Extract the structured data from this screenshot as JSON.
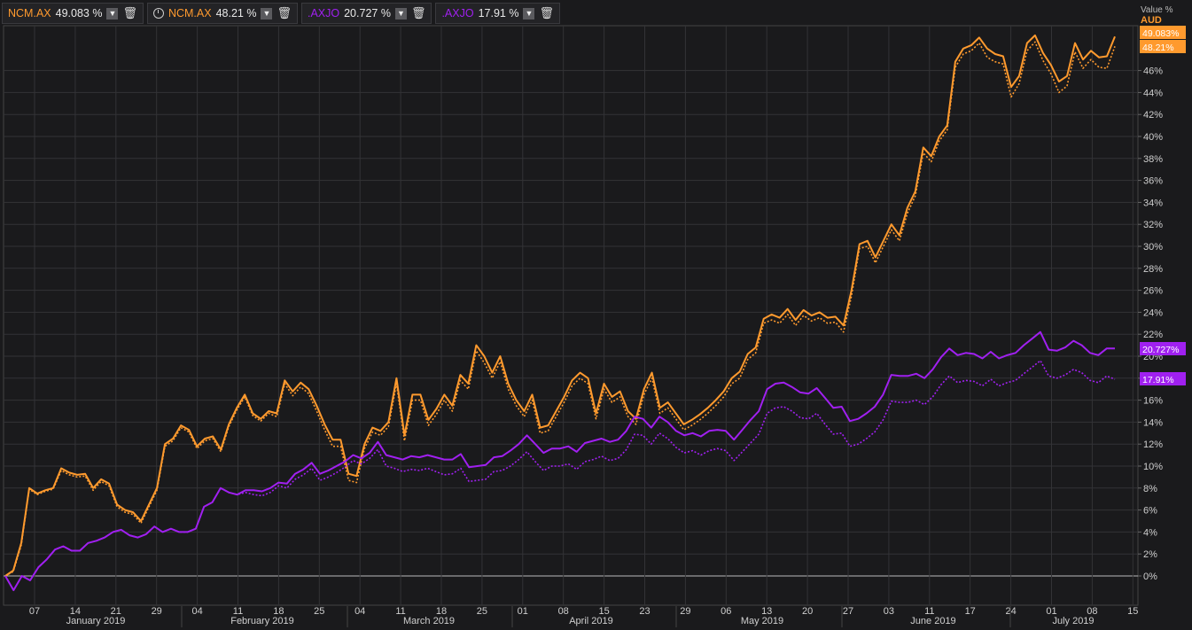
{
  "legend": [
    {
      "symbol": "NCM.AX",
      "value": "49.083 %",
      "color": "#ff9a2e",
      "clock": false
    },
    {
      "symbol": "NCM.AX",
      "value": "48.21 %",
      "color": "#ff9a2e",
      "clock": true
    },
    {
      "symbol": ".AXJO",
      "value": "20.727 %",
      "color": "#a020f0",
      "clock": false
    },
    {
      "symbol": ".AXJO",
      "value": "17.91 %",
      "color": "#a020f0",
      "clock": false
    }
  ],
  "axis_header": {
    "line1": "Value %",
    "line2": "AUD"
  },
  "colors": {
    "orange": "#ff9a2e",
    "purple": "#a020f0",
    "bg": "#1a1a1c",
    "grid": "#333336"
  },
  "chart_data": {
    "type": "line",
    "ylim": [
      -2,
      52
    ],
    "yticks": [
      "0%",
      "2%",
      "4%",
      "6%",
      "8%",
      "10%",
      "12%",
      "14%",
      "16%",
      "18%",
      "20%",
      "22%",
      "24%",
      "26%",
      "28%",
      "30%",
      "32%",
      "34%",
      "36%",
      "38%",
      "40%",
      "42%",
      "44%",
      "46%"
    ],
    "xticks": [
      "07",
      "14",
      "21",
      "29",
      "04",
      "11",
      "18",
      "25",
      "04",
      "11",
      "18",
      "25",
      "01",
      "08",
      "15",
      "23",
      "29",
      "06",
      "13",
      "20",
      "27",
      "03",
      "11",
      "17",
      "24",
      "01",
      "08",
      "15"
    ],
    "months": [
      "January 2019",
      "February 2019",
      "March 2019",
      "April 2019",
      "May 2019",
      "June 2019",
      "July 2019"
    ],
    "end_labels": [
      "49.083%",
      "48.21%",
      "20.727%",
      "17.91%"
    ],
    "series": [
      {
        "name": "NCM.AX",
        "style": "solid",
        "color": "#ff9a2e",
        "values": [
          0,
          0.5,
          3,
          8,
          7.5,
          7.8,
          8,
          9.8,
          9.4,
          9.2,
          9.3,
          8,
          8.8,
          8.4,
          6.5,
          6,
          5.8,
          5,
          6.5,
          8,
          12,
          12.5,
          13.7,
          13.3,
          11.8,
          12.5,
          12.7,
          11.5,
          13.8,
          15.3,
          16.5,
          14.8,
          14.3,
          15,
          14.8,
          17.8,
          16.8,
          17.6,
          17,
          15.5,
          13.8,
          12.4,
          12.4,
          9.3,
          9.1,
          12,
          13.5,
          13.2,
          14,
          18,
          12.8,
          16.5,
          16.5,
          14.2,
          15.2,
          16.5,
          15.5,
          18.3,
          17.5,
          21,
          20,
          18.5,
          20,
          17.5,
          16,
          15,
          16.5,
          13.5,
          13.7,
          15,
          16.3,
          17.8,
          18.5,
          18,
          14.8,
          17.5,
          16.3,
          16.8,
          15,
          14.3,
          17,
          18.5,
          15.3,
          15.8,
          14.8,
          13.8,
          14.2,
          14.7,
          15.3,
          16,
          16.8,
          18,
          18.6,
          20.2,
          20.8,
          23.4,
          23.8,
          23.5,
          24.3,
          23.3,
          24.2,
          23.7,
          24,
          23.5,
          23.6,
          22.8,
          26,
          30.2,
          30.5,
          29,
          30.5,
          32,
          31,
          33.5,
          35,
          39,
          38.2,
          40,
          41,
          46.8,
          48,
          48.3,
          49,
          48,
          47.5,
          47.3,
          44.5,
          45.5,
          48.5,
          49.2,
          47.6,
          46.5,
          45,
          45.5,
          48.5,
          47,
          47.8,
          47.2,
          47.3,
          49.1
        ]
      },
      {
        "name": "NCM.AX",
        "style": "dotted",
        "color": "#ff9a2e",
        "values": [
          0,
          0.4,
          2.8,
          7.9,
          7.4,
          7.7,
          7.9,
          9.6,
          9.2,
          9,
          9.1,
          7.8,
          8.6,
          8.2,
          6.3,
          5.8,
          5.6,
          4.8,
          6.3,
          7.8,
          11.8,
          12.3,
          13.5,
          13.1,
          11.6,
          12.3,
          12.5,
          11.3,
          13.6,
          15.1,
          16.3,
          14.6,
          14.1,
          14.8,
          14.5,
          17.5,
          16.4,
          17.2,
          16.6,
          15,
          13.3,
          11.8,
          11.8,
          8.7,
          8.5,
          11.6,
          13.1,
          12.8,
          13.6,
          17.5,
          12.3,
          16,
          16,
          13.7,
          14.7,
          16,
          15,
          17.8,
          17,
          20.5,
          19.4,
          18,
          19.5,
          17,
          15.5,
          14.5,
          16,
          13,
          13.2,
          14.5,
          15.8,
          17.3,
          18,
          17.5,
          14.3,
          17,
          15.8,
          16.3,
          14.5,
          13.8,
          16.5,
          18,
          14.8,
          15.3,
          14.3,
          13.3,
          13.7,
          14.2,
          14.8,
          15.5,
          16.3,
          17.5,
          18,
          19.7,
          20.3,
          23,
          23.3,
          23,
          23.8,
          22.8,
          23.7,
          23.2,
          23.5,
          23,
          23.1,
          22.2,
          25.5,
          29.8,
          30,
          28.5,
          30,
          31.5,
          30.5,
          33,
          34.6,
          38.5,
          37.7,
          39.6,
          40.6,
          46.3,
          47.5,
          47.8,
          48.5,
          47.2,
          46.8,
          46.6,
          43.6,
          44.8,
          47.8,
          48.6,
          46.9,
          45.7,
          44,
          44.6,
          47.7,
          46.2,
          47,
          46.3,
          46.2,
          48.2
        ]
      },
      {
        "name": ".AXJO",
        "style": "solid",
        "color": "#a020f0",
        "values": [
          0,
          -1.3,
          0,
          -0.4,
          0.8,
          1.5,
          2.4,
          2.7,
          2.3,
          2.3,
          3,
          3.2,
          3.5,
          4,
          4.2,
          3.7,
          3.5,
          3.8,
          4.5,
          4,
          4.3,
          4,
          4,
          4.3,
          6.3,
          6.7,
          8,
          7.6,
          7.4,
          7.8,
          7.8,
          7.7,
          8,
          8.5,
          8.4,
          9.3,
          9.7,
          10.3,
          9.3,
          9.6,
          10,
          10.4,
          11,
          10.7,
          11.2,
          12.2,
          11,
          10.8,
          10.6,
          10.9,
          10.8,
          11,
          10.8,
          10.6,
          10.6,
          11.1,
          9.9,
          10,
          10.1,
          10.8,
          10.9,
          11.4,
          12,
          12.8,
          12,
          11.2,
          11.6,
          11.6,
          11.8,
          11.3,
          12.1,
          12.3,
          12.5,
          12.2,
          12.4,
          13.2,
          14.5,
          14.3,
          13.5,
          14.5,
          14,
          13.2,
          12.8,
          13,
          12.7,
          13.2,
          13.3,
          13.2,
          12.4,
          13.3,
          14.2,
          15,
          17,
          17.5,
          17.6,
          17.2,
          16.7,
          16.6,
          17.1,
          16.2,
          15.3,
          15.4,
          14.1,
          14.3,
          14.8,
          15.4,
          16.5,
          18.3,
          18.2,
          18.2,
          18.4,
          18,
          18.8,
          19.9,
          20.7,
          20.1,
          20.3,
          20.2,
          19.8,
          20.4,
          19.8,
          20.1,
          20.3,
          21,
          21.6,
          22.2,
          20.6,
          20.5,
          20.8,
          21.4,
          21,
          20.3,
          20.1,
          20.7,
          20.7
        ]
      },
      {
        "name": ".AXJO",
        "style": "dotted",
        "color": "#a020f0",
        "values": [
          0,
          -1.3,
          0,
          -0.4,
          0.8,
          1.5,
          2.4,
          2.7,
          2.3,
          2.3,
          3,
          3.2,
          3.5,
          4,
          4.2,
          3.7,
          3.5,
          3.8,
          4.5,
          4,
          4.3,
          4,
          4,
          4.3,
          6.3,
          6.7,
          8,
          7.6,
          7.4,
          7.6,
          7.4,
          7.3,
          7.6,
          8.2,
          8,
          8.8,
          9.2,
          9.8,
          8.7,
          9,
          9.4,
          9.9,
          10.5,
          10.2,
          10.7,
          11.5,
          10,
          9.8,
          9.5,
          9.7,
          9.6,
          9.8,
          9.5,
          9.2,
          9.3,
          9.8,
          8.6,
          8.7,
          8.8,
          9.5,
          9.6,
          10,
          10.6,
          11.3,
          10.4,
          9.6,
          10,
          10,
          10.2,
          9.7,
          10.4,
          10.6,
          10.9,
          10.5,
          10.7,
          11.5,
          12.9,
          12.8,
          12,
          13,
          12.5,
          11.7,
          11.2,
          11.4,
          11,
          11.4,
          11.6,
          11.4,
          10.5,
          11.3,
          12.1,
          12.9,
          14.8,
          15.3,
          15.4,
          15,
          14.4,
          14.3,
          14.8,
          13.8,
          12.9,
          13,
          11.8,
          12,
          12.5,
          13.1,
          14.2,
          15.9,
          15.8,
          15.8,
          16,
          15.6,
          16.3,
          17.4,
          18.2,
          17.6,
          17.8,
          17.7,
          17.3,
          17.9,
          17.3,
          17.6,
          17.8,
          18.4,
          19,
          19.6,
          18.2,
          18,
          18.3,
          18.8,
          18.5,
          17.8,
          17.6,
          18.2,
          17.9
        ]
      }
    ]
  }
}
